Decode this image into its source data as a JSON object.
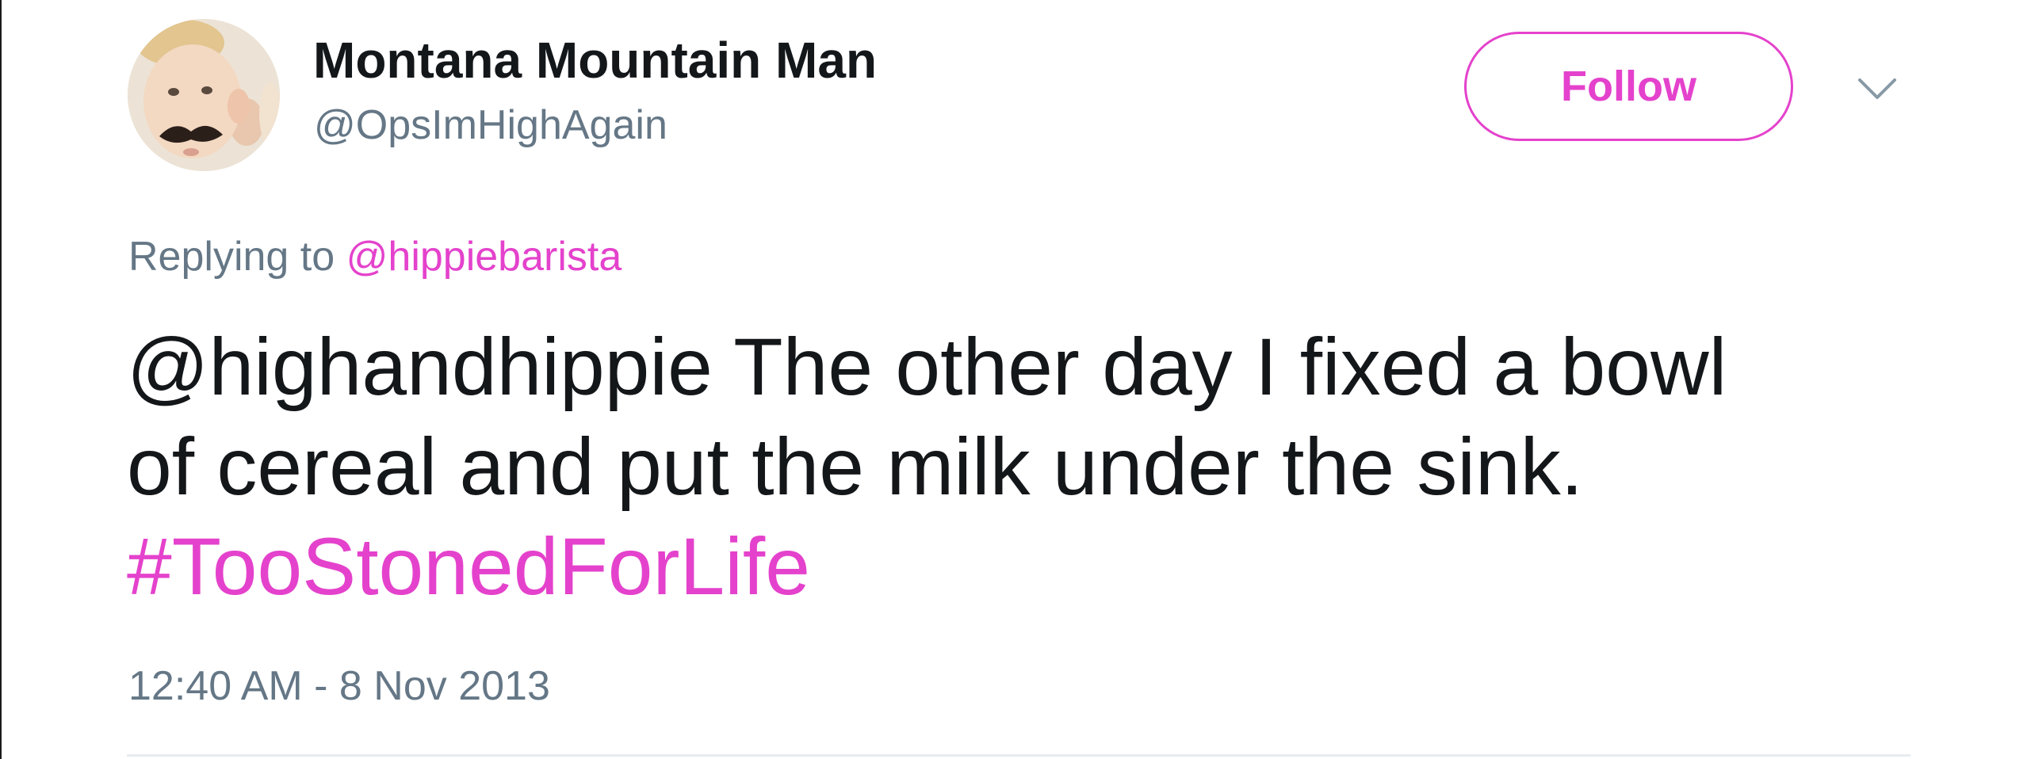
{
  "tweet": {
    "author": {
      "display_name": "Montana Mountain Man",
      "handle": "@OpsImHighAgain"
    },
    "follow_label": "Follow",
    "reply_prefix": "Replying to",
    "reply_to": "@hippiebarista",
    "text_line_1": "@highandhippie The other day I fixed a bowl",
    "text_line_2": "of cereal and put the milk under the sink.",
    "hashtag": "#TooStonedForLife",
    "timestamp": "12:40 AM - 8 Nov 2013"
  },
  "icons": {
    "avatar": "baby-with-mustache-avatar",
    "menu": "chevron-down-icon"
  },
  "colors": {
    "accent": "#e442cc",
    "secondary_text": "#657786",
    "primary_text": "#14171a"
  }
}
